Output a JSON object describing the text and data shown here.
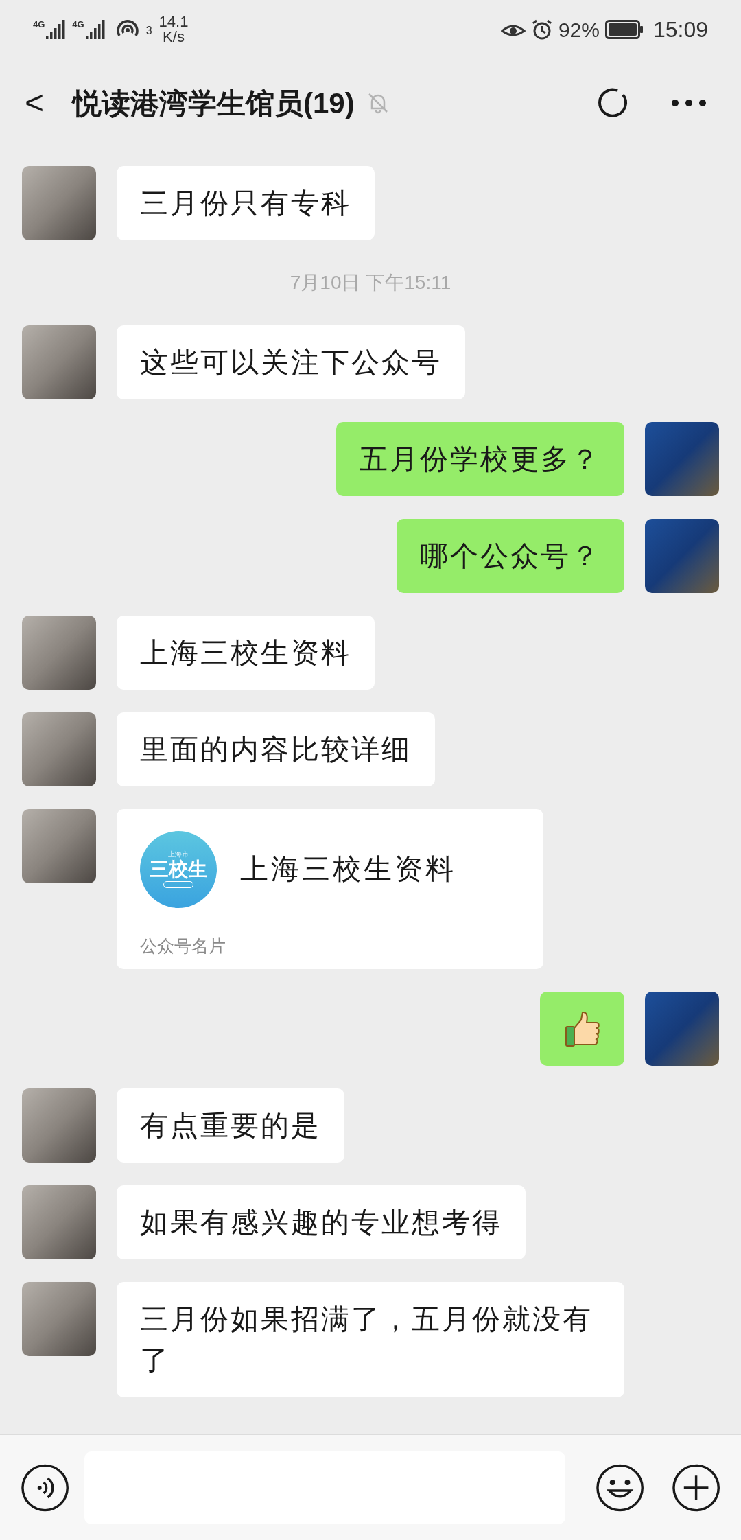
{
  "status_bar": {
    "signals": [
      {
        "label": "4G"
      },
      {
        "label": "4G"
      }
    ],
    "hotspot_count": "3",
    "speed": "14.1",
    "speed_unit": "K/s",
    "battery": "92%",
    "time": "15:09"
  },
  "header": {
    "back": "<",
    "title": "悦读港湾学生馆员(19)",
    "muted": true
  },
  "messages": [
    {
      "kind": "text",
      "outgoing": false,
      "text": "三月份只有专科"
    },
    {
      "kind": "time",
      "text": "7月10日 下午15:11"
    },
    {
      "kind": "text",
      "outgoing": false,
      "text": "这些可以关注下公众号"
    },
    {
      "kind": "text",
      "outgoing": true,
      "text": "五月份学校更多？"
    },
    {
      "kind": "text",
      "outgoing": true,
      "text": "哪个公众号？"
    },
    {
      "kind": "text",
      "outgoing": false,
      "text": "上海三校生资料"
    },
    {
      "kind": "text",
      "outgoing": false,
      "text": "里面的内容比较详细"
    },
    {
      "kind": "card",
      "outgoing": false,
      "logo_top": "上海市",
      "logo_main": "三校生",
      "title": "上海三校生资料",
      "footer": "公众号名片"
    },
    {
      "kind": "emoji",
      "outgoing": true
    },
    {
      "kind": "text",
      "outgoing": false,
      "text": "有点重要的是"
    },
    {
      "kind": "text",
      "outgoing": false,
      "text": "如果有感兴趣的专业想考得"
    },
    {
      "kind": "text",
      "outgoing": false,
      "text": "三月份如果招满了，五月份就没有了"
    }
  ]
}
